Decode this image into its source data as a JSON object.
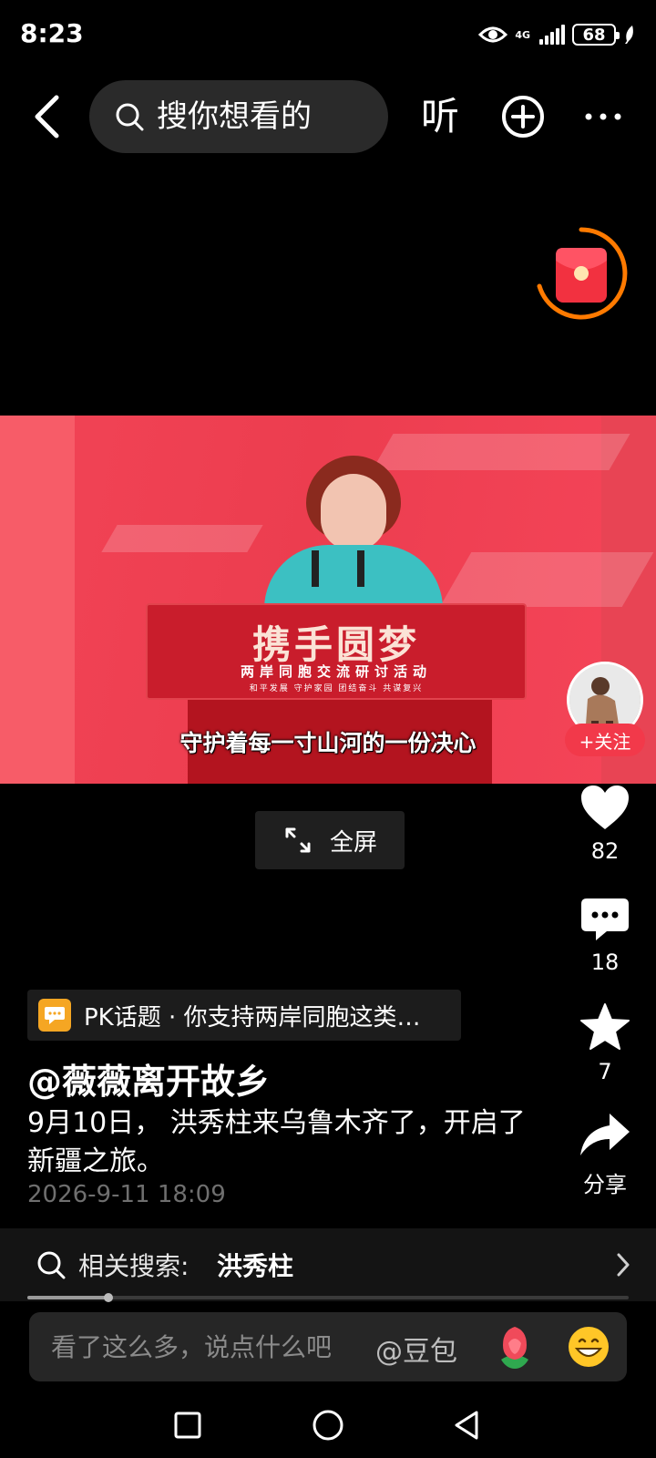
{
  "status_bar": {
    "time": "8:23",
    "network": "4G",
    "battery": "68",
    "icons": [
      "eye-icon",
      "signal-icon",
      "battery-icon",
      "leaf-icon"
    ]
  },
  "top_bar": {
    "search_placeholder": "搜你想看的",
    "listen_label": "听",
    "icons": [
      "back-icon",
      "search-icon",
      "plus-circle-icon",
      "more-icon"
    ]
  },
  "video": {
    "caption": "守护着每一寸山河的一份决心",
    "banner_logo": "携手圆梦",
    "banner_title": "两岸同胞交流研讨活动",
    "banner_subtitle": "和平发展 守护家园 团结奋斗 共谋复兴",
    "fullscreen_label": "全屏"
  },
  "sidebar": {
    "follow_label": "+关注",
    "likes": "82",
    "comments": "18",
    "favorites": "7",
    "share_label": "分享"
  },
  "post": {
    "topic": "PK话题 · 你支持两岸同胞这类…",
    "author": "@薇薇离开故乡",
    "description": "9月10日， 洪秀柱来乌鲁木齐了，开启了新疆之旅。",
    "time": "2026-9-11 18:09"
  },
  "related_search": {
    "label": "相关搜索:",
    "term": "洪秀柱"
  },
  "playback": {
    "progress": 0.135
  },
  "comment_bar": {
    "placeholder": "看了这么多，说点什么吧",
    "mention": "@豆包"
  },
  "colors": {
    "accent_red": "#f2394a",
    "packet_ring": "#ff7a00",
    "topic_icon": "#f5a623"
  }
}
